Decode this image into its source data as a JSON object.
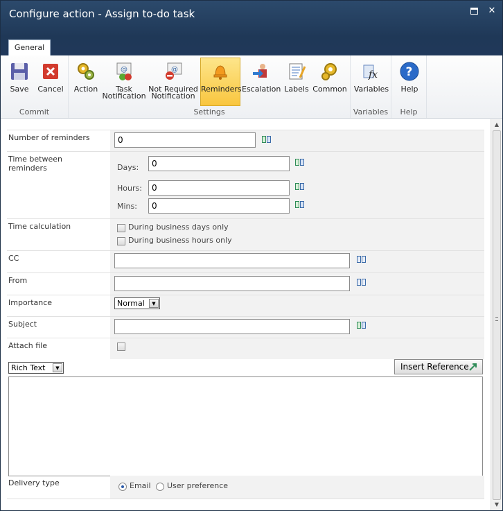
{
  "window": {
    "title": "Configure action - Assign to-do task"
  },
  "ribbon": {
    "tab": "General",
    "groups": {
      "commit": "Commit",
      "settings": "Settings",
      "variables": "Variables",
      "help": "Help"
    },
    "buttons": {
      "save": "Save",
      "cancel": "Cancel",
      "action": "Action",
      "task_notification_1": "Task",
      "task_notification_2": "Notification",
      "not_required_1": "Not Required",
      "not_required_2": "Notification",
      "reminders": "Reminders",
      "escalation": "Escalation",
      "labels": "Labels",
      "common": "Common",
      "variables": "Variables",
      "help": "Help"
    }
  },
  "form": {
    "number_of_reminders": {
      "label": "Number of reminders",
      "value": "0"
    },
    "time_between": {
      "label": "Time between reminders",
      "days_label": "Days:",
      "days_value": "0",
      "hours_label": "Hours:",
      "hours_value": "0",
      "mins_label": "Mins:",
      "mins_value": "0"
    },
    "time_calculation": {
      "label": "Time calculation",
      "opt1": "During business days only",
      "opt2": "During business hours only"
    },
    "cc": {
      "label": "CC",
      "value": ""
    },
    "from": {
      "label": "From",
      "value": ""
    },
    "importance": {
      "label": "Importance",
      "value": "Normal"
    },
    "subject": {
      "label": "Subject",
      "value": ""
    },
    "attach_file": {
      "label": "Attach file"
    },
    "body": {
      "format": "Rich Text",
      "insert_reference": "Insert Reference"
    },
    "delivery_type": {
      "label": "Delivery type",
      "opt_email": "Email",
      "opt_user_pref": "User preference",
      "selected": "Email"
    }
  }
}
